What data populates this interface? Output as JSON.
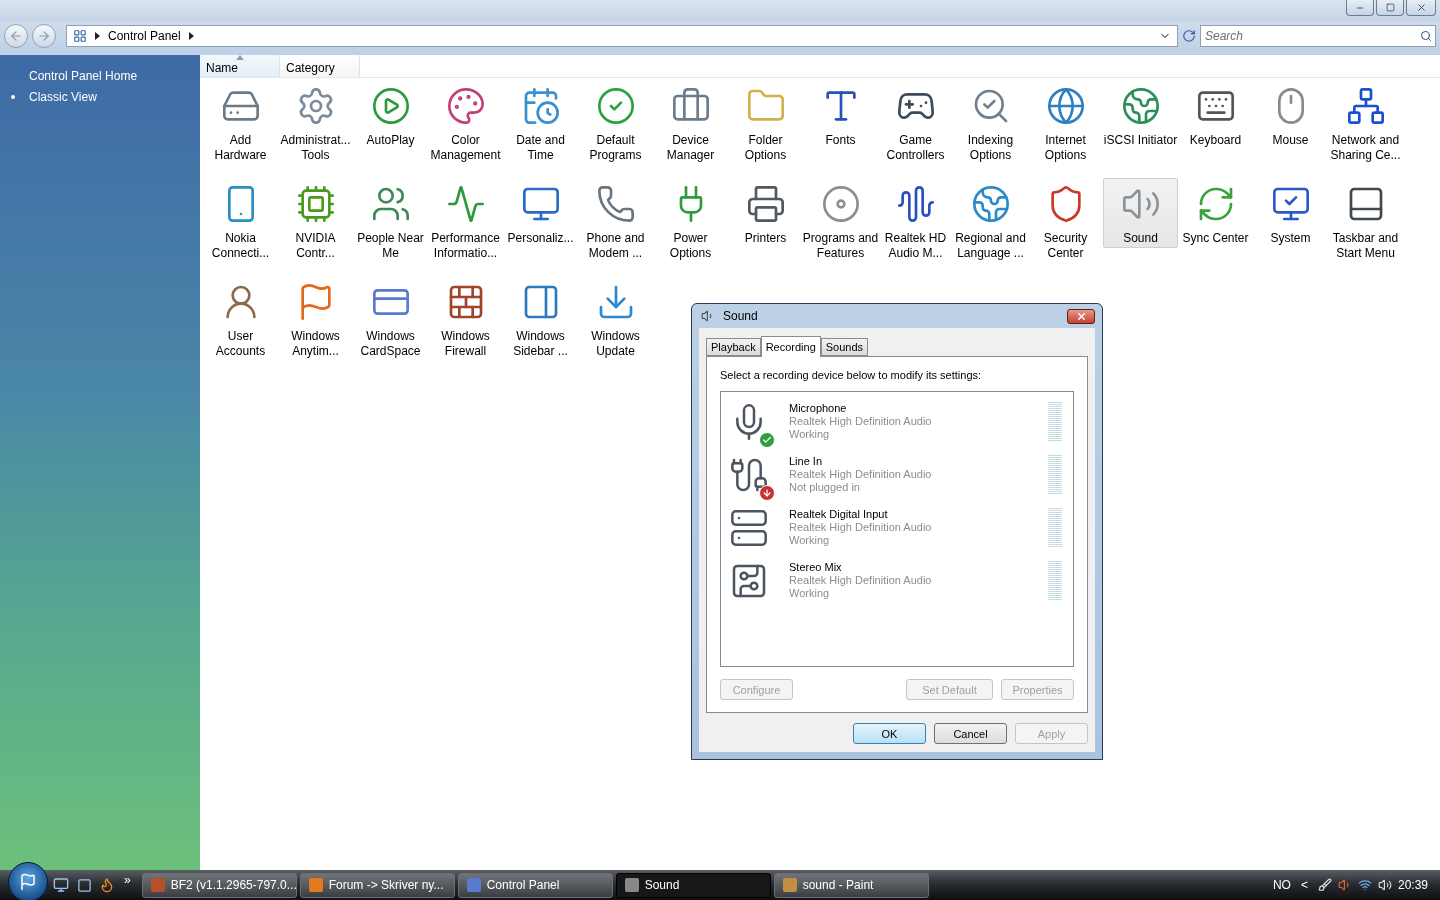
{
  "address_bar": {
    "crumbs": [
      "Control Panel"
    ],
    "search": {
      "placeholder": "Search"
    }
  },
  "sidebar": {
    "items": [
      {
        "label": "Control Panel Home",
        "selected": false
      },
      {
        "label": "Classic View",
        "selected": true
      }
    ]
  },
  "columns": [
    {
      "label": "Name",
      "selected": true
    },
    {
      "label": "Category",
      "selected": false
    }
  ],
  "applets": [
    {
      "label": "Add Hardware",
      "selected": false
    },
    {
      "label": "Administrat... Tools",
      "selected": false
    },
    {
      "label": "AutoPlay",
      "selected": false
    },
    {
      "label": "Color Management",
      "selected": false
    },
    {
      "label": "Date and Time",
      "selected": false
    },
    {
      "label": "Default Programs",
      "selected": false
    },
    {
      "label": "Device Manager",
      "selected": false
    },
    {
      "label": "Folder Options",
      "selected": false
    },
    {
      "label": "Fonts",
      "selected": false
    },
    {
      "label": "Game Controllers",
      "selected": false
    },
    {
      "label": "Indexing Options",
      "selected": false
    },
    {
      "label": "Internet Options",
      "selected": false
    },
    {
      "label": "iSCSI Initiator",
      "selected": false
    },
    {
      "label": "Keyboard",
      "selected": false
    },
    {
      "label": "Mouse",
      "selected": false
    },
    {
      "label": "Network and Sharing Ce...",
      "selected": false
    },
    {
      "label": "Nokia Connecti...",
      "selected": false
    },
    {
      "label": "NVIDIA Contr...",
      "selected": false
    },
    {
      "label": "People Near Me",
      "selected": false
    },
    {
      "label": "Performance Informatio...",
      "selected": false
    },
    {
      "label": "Personaliz...",
      "selected": false
    },
    {
      "label": "Phone and Modem ...",
      "selected": false
    },
    {
      "label": "Power Options",
      "selected": false
    },
    {
      "label": "Printers",
      "selected": false
    },
    {
      "label": "Programs and Features",
      "selected": false
    },
    {
      "label": "Realtek HD Audio M...",
      "selected": false
    },
    {
      "label": "Regional and Language ...",
      "selected": false
    },
    {
      "label": "Security Center",
      "selected": false
    },
    {
      "label": "Sound",
      "selected": true
    },
    {
      "label": "Sync Center",
      "selected": false
    },
    {
      "label": "System",
      "selected": false
    },
    {
      "label": "Taskbar and Start Menu",
      "selected": false
    },
    {
      "label": "User Accounts",
      "selected": false
    },
    {
      "label": "Windows Anytim...",
      "selected": false
    },
    {
      "label": "Windows CardSpace",
      "selected": false
    },
    {
      "label": "Windows Firewall",
      "selected": false
    },
    {
      "label": "Windows Sidebar ...",
      "selected": false
    },
    {
      "label": "Windows Update",
      "selected": false
    }
  ],
  "dialog": {
    "title": "Sound",
    "tabs": [
      {
        "label": "Playback",
        "selected": false
      },
      {
        "label": "Recording",
        "selected": true
      },
      {
        "label": "Sounds",
        "selected": false
      }
    ],
    "instruction": "Select a recording device below to modify its settings:",
    "devices": [
      {
        "name": "Microphone",
        "driver": "Realtek High Definition Audio",
        "status": "Working",
        "default": true,
        "plugged_in": true
      },
      {
        "name": "Line In",
        "driver": "Realtek High Definition Audio",
        "status": "Not plugged in",
        "default": false,
        "plugged_in": false
      },
      {
        "name": "Realtek Digital Input",
        "driver": "Realtek High Definition Audio",
        "status": "Working",
        "default": false,
        "plugged_in": true
      },
      {
        "name": "Stereo Mix",
        "driver": "Realtek High Definition Audio",
        "status": "Working",
        "default": false,
        "plugged_in": true
      }
    ],
    "list_buttons": [
      {
        "label": "Configure",
        "disabled": true
      },
      {
        "label": "Set Default",
        "disabled": true
      },
      {
        "label": "Properties",
        "disabled": true
      }
    ],
    "buttons": [
      {
        "label": "OK",
        "disabled": false,
        "default": true
      },
      {
        "label": "Cancel",
        "disabled": false,
        "default": false
      },
      {
        "label": "Apply",
        "disabled": true,
        "default": false
      }
    ]
  },
  "taskbar": {
    "more": "»",
    "tasks": [
      {
        "label": "BF2 (v1.1.2965-797.0...",
        "selected": false
      },
      {
        "label": "Forum -> Skriver ny...",
        "selected": false
      },
      {
        "label": "Control Panel",
        "selected": false
      },
      {
        "label": "Sound",
        "selected": true
      },
      {
        "label": "sound - Paint",
        "selected": false
      }
    ],
    "language": "NO",
    "tray_toggle": "<",
    "clock": "20:39"
  }
}
